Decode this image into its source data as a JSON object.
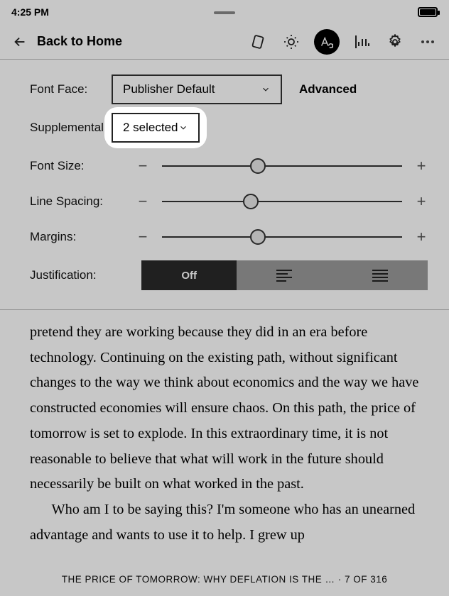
{
  "status": {
    "time": "4:25 PM"
  },
  "toolbar": {
    "back_label": "Back to Home"
  },
  "settings": {
    "font_face_label": "Font Face:",
    "font_face_value": "Publisher Default",
    "advanced_label": "Advanced",
    "supplemental_label": "Supplemental:",
    "supplemental_value": "2 selected",
    "font_size_label": "Font Size:",
    "line_spacing_label": "Line Spacing:",
    "margins_label": "Margins:",
    "justification_label": "Justification:",
    "justification_off": "Off",
    "sliders": {
      "font_size_pct": 40,
      "line_spacing_pct": 37,
      "margins_pct": 40
    }
  },
  "reading": {
    "para1": "pretend they are working because they did in an era before technology. Continuing on the existing path, without significant changes to the way we think about economics and the way we have constructed economies will ensure chaos. On this path, the price of tomorrow is set to explode. In this extraordinary time, it is not reasonable to believe that what will work in the future should necessarily be built on what worked in the past.",
    "para2": "Who am I to be saying this? I'm someone who has an unearned advantage and wants to use it to help. I grew up"
  },
  "footer": {
    "title": "THE PRICE OF TOMORROW: WHY DEFLATION IS THE …",
    "sep": " · ",
    "page": "7 OF 316"
  }
}
